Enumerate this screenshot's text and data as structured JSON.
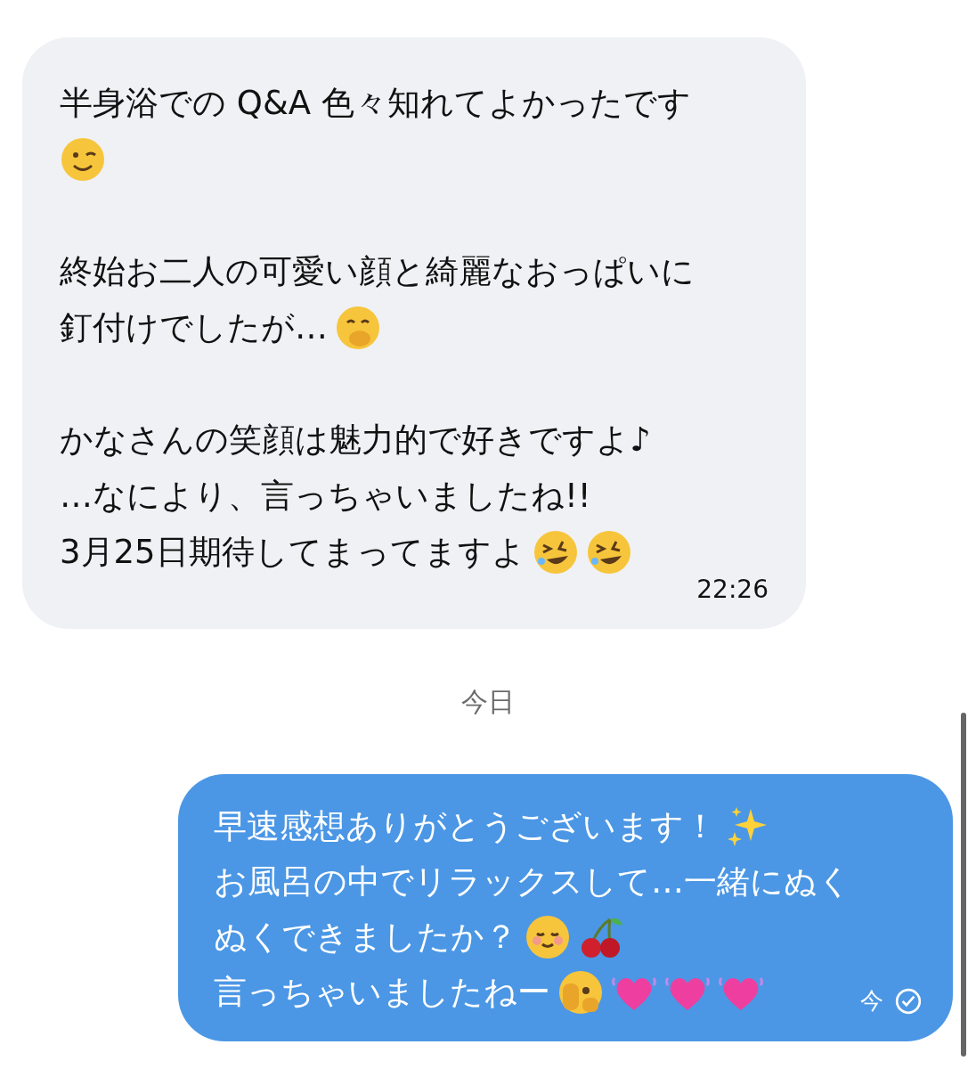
{
  "messages": [
    {
      "kind": "incoming",
      "paragraphs": [
        [
          [
            {
              "kind": "text",
              "text": "半身浴での Q&A 色々知れてよかったです"
            }
          ],
          [
            {
              "kind": "wink"
            }
          ]
        ],
        [
          [
            {
              "kind": "text",
              "text": "終始お二人の可愛い顔と綺麗なおっぱいに"
            }
          ],
          [
            {
              "kind": "text",
              "text": "釘付けでしたが…"
            },
            {
              "kind": "hand-over-mouth"
            }
          ]
        ],
        [
          [
            {
              "kind": "text",
              "text": "かなさんの笑顔は魅力的で好きですよ♪"
            }
          ],
          [
            {
              "kind": "text",
              "text": "…なにより、言っちゃいましたね!!"
            }
          ],
          [
            {
              "kind": "text",
              "text": "3月25日期待してまってますよ"
            },
            {
              "kind": "rofl"
            },
            {
              "kind": "rofl"
            }
          ]
        ]
      ],
      "time": "22:26"
    },
    {
      "kind": "separator",
      "label": "今日"
    },
    {
      "kind": "outgoing",
      "paragraphs": [
        [
          [
            {
              "kind": "text",
              "text": "早速感想ありがとうございます！"
            },
            {
              "kind": "sparkles"
            }
          ],
          [
            {
              "kind": "text",
              "text": "お風呂の中でリラックスして…一緒にぬく"
            }
          ],
          [
            {
              "kind": "text",
              "text": "ぬくできましたか？"
            },
            {
              "kind": "smile"
            },
            {
              "kind": "cherries"
            }
          ],
          [
            {
              "kind": "text",
              "text": "言っちゃいましたねー"
            },
            {
              "kind": "peek"
            },
            {
              "kind": "heart"
            },
            {
              "kind": "heart"
            },
            {
              "kind": "heart"
            }
          ]
        ]
      ],
      "time": "今",
      "read": true
    }
  ]
}
